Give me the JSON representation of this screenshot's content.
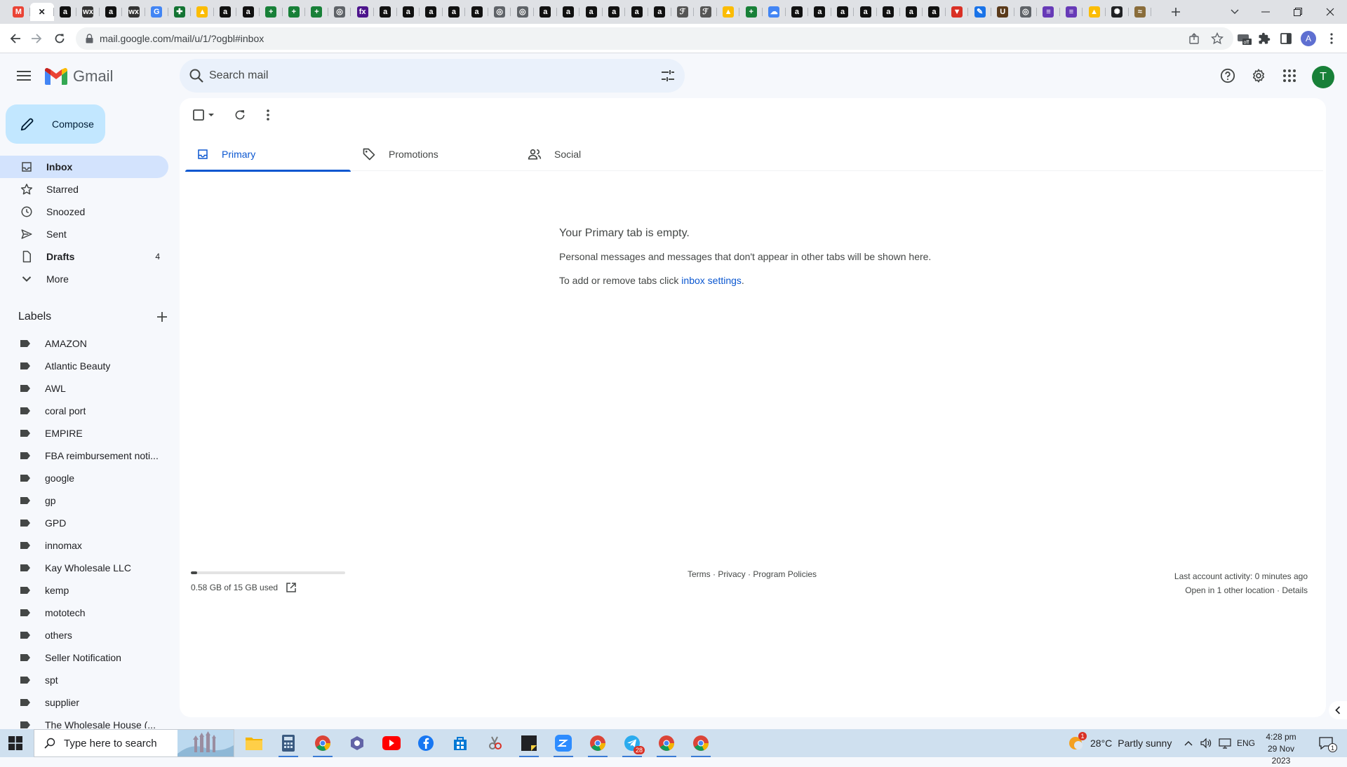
{
  "browser": {
    "tabs": [
      {
        "icon": "gmail-icon",
        "color": "#ea4335",
        "glyph": "M",
        "active": false
      },
      {
        "icon": "close-icon",
        "color": "#202124",
        "glyph": "✕",
        "active": true
      },
      {
        "icon": "amazon-icon",
        "color": "#111",
        "glyph": "a",
        "active": false
      },
      {
        "icon": "wix-icon",
        "color": "#333",
        "glyph": "wx",
        "active": false
      },
      {
        "icon": "amazon-icon",
        "color": "#111",
        "glyph": "a",
        "active": false
      },
      {
        "icon": "wix-icon",
        "color": "#333",
        "glyph": "wx",
        "active": false
      },
      {
        "icon": "google-icon",
        "color": "#4285f4",
        "glyph": "G",
        "active": false
      },
      {
        "icon": "extension-icon",
        "color": "#137333",
        "glyph": "✚",
        "active": false
      },
      {
        "icon": "drive-icon",
        "color": "#fbbc04",
        "glyph": "▲",
        "active": false
      },
      {
        "icon": "amazon-icon",
        "color": "#111",
        "glyph": "a",
        "active": false
      },
      {
        "icon": "amazon-icon",
        "color": "#111",
        "glyph": "a",
        "active": false
      },
      {
        "icon": "sheets-icon",
        "color": "#188038",
        "glyph": "+",
        "active": false
      },
      {
        "icon": "sheets-icon",
        "color": "#188038",
        "glyph": "+",
        "active": false
      },
      {
        "icon": "sheets-icon",
        "color": "#188038",
        "glyph": "+",
        "active": false
      },
      {
        "icon": "globe-icon",
        "color": "#5f6368",
        "glyph": "◎",
        "active": false
      },
      {
        "icon": "fedex-icon",
        "color": "#4d148c",
        "glyph": "fx",
        "active": false
      },
      {
        "icon": "amazon-icon",
        "color": "#111",
        "glyph": "a",
        "active": false
      },
      {
        "icon": "amazon-icon",
        "color": "#111",
        "glyph": "a",
        "active": false
      },
      {
        "icon": "amazon-icon",
        "color": "#111",
        "glyph": "a",
        "active": false
      },
      {
        "icon": "amazon-icon",
        "color": "#111",
        "glyph": "a",
        "active": false
      },
      {
        "icon": "amazon-icon",
        "color": "#111",
        "glyph": "a",
        "active": false
      },
      {
        "icon": "globe-icon",
        "color": "#5f6368",
        "glyph": "◎",
        "active": false
      },
      {
        "icon": "globe-icon",
        "color": "#5f6368",
        "glyph": "◎",
        "active": false
      },
      {
        "icon": "amazon-icon",
        "color": "#111",
        "glyph": "a",
        "active": false
      },
      {
        "icon": "amazon-icon",
        "color": "#111",
        "glyph": "a",
        "active": false
      },
      {
        "icon": "amazon-icon",
        "color": "#111",
        "glyph": "a",
        "active": false
      },
      {
        "icon": "amazon-icon",
        "color": "#111",
        "glyph": "a",
        "active": false
      },
      {
        "icon": "amazon-icon",
        "color": "#111",
        "glyph": "a",
        "active": false
      },
      {
        "icon": "amazon-icon",
        "color": "#111",
        "glyph": "a",
        "active": false
      },
      {
        "icon": "script-icon",
        "color": "#555",
        "glyph": "ℱ",
        "active": false
      },
      {
        "icon": "script-icon",
        "color": "#555",
        "glyph": "ℱ",
        "active": false
      },
      {
        "icon": "drive-icon",
        "color": "#fbbc04",
        "glyph": "▲",
        "active": false
      },
      {
        "icon": "sheets-icon",
        "color": "#188038",
        "glyph": "+",
        "active": false
      },
      {
        "icon": "cloud-icon",
        "color": "#4285f4",
        "glyph": "☁",
        "active": false
      },
      {
        "icon": "amazon-icon",
        "color": "#111",
        "glyph": "a",
        "active": false
      },
      {
        "icon": "amazon-icon",
        "color": "#111",
        "glyph": "a",
        "active": false
      },
      {
        "icon": "amazon-icon",
        "color": "#111",
        "glyph": "a",
        "active": false
      },
      {
        "icon": "amazon-icon",
        "color": "#111",
        "glyph": "a",
        "active": false
      },
      {
        "icon": "amazon-icon",
        "color": "#111",
        "glyph": "a",
        "active": false
      },
      {
        "icon": "amazon-icon",
        "color": "#111",
        "glyph": "a",
        "active": false
      },
      {
        "icon": "amazon-icon",
        "color": "#111",
        "glyph": "a",
        "active": false
      },
      {
        "icon": "vivaldi-icon",
        "color": "#d93025",
        "glyph": "▼",
        "active": false
      },
      {
        "icon": "pen-icon",
        "color": "#1a73e8",
        "glyph": "✎",
        "active": false
      },
      {
        "icon": "ups-icon",
        "color": "#5a3a1a",
        "glyph": "U",
        "active": false
      },
      {
        "icon": "globe-icon",
        "color": "#5f6368",
        "glyph": "◎",
        "active": false
      },
      {
        "icon": "forms-icon",
        "color": "#673ab7",
        "glyph": "≡",
        "active": false
      },
      {
        "icon": "forms-icon",
        "color": "#673ab7",
        "glyph": "≡",
        "active": false
      },
      {
        "icon": "drive-icon",
        "color": "#fbbc04",
        "glyph": "▲",
        "active": false
      },
      {
        "icon": "chatgpt-icon",
        "color": "#202124",
        "glyph": "✺",
        "active": false
      },
      {
        "icon": "shipping-icon",
        "color": "#8a6d3b",
        "glyph": "≈",
        "active": false
      }
    ],
    "url": "mail.google.com/mail/u/1/?ogbl#inbox",
    "profile_initial": "A"
  },
  "gmail": {
    "app_name": "Gmail",
    "search_placeholder": "Search mail",
    "user_initial": "T",
    "compose_label": "Compose",
    "nav": [
      {
        "id": "inbox",
        "label": "Inbox",
        "icon": "inbox-icon",
        "count": "",
        "active": true,
        "bold": true
      },
      {
        "id": "starred",
        "label": "Starred",
        "icon": "star-icon",
        "count": "",
        "active": false,
        "bold": false
      },
      {
        "id": "snoozed",
        "label": "Snoozed",
        "icon": "clock-icon",
        "count": "",
        "active": false,
        "bold": false
      },
      {
        "id": "sent",
        "label": "Sent",
        "icon": "send-icon",
        "count": "",
        "active": false,
        "bold": false
      },
      {
        "id": "drafts",
        "label": "Drafts",
        "icon": "draft-icon",
        "count": "4",
        "active": false,
        "bold": true
      },
      {
        "id": "more",
        "label": "More",
        "icon": "chevron-down-icon",
        "count": "",
        "active": false,
        "bold": false
      }
    ],
    "labels_title": "Labels",
    "labels": [
      "AMAZON",
      "Atlantic Beauty",
      "AWL",
      "coral port",
      "EMPIRE",
      "FBA reimbursement noti...",
      "google",
      "gp",
      "GPD",
      "innomax",
      "Kay Wholesale LLC",
      "kemp",
      "mototech",
      "others",
      "Seller Notification",
      "spt",
      "supplier",
      "The Wholesale House (..."
    ],
    "category_tabs": [
      {
        "id": "primary",
        "label": "Primary",
        "icon": "inbox-icon",
        "active": true
      },
      {
        "id": "promotions",
        "label": "Promotions",
        "icon": "tag-icon",
        "active": false
      },
      {
        "id": "social",
        "label": "Social",
        "icon": "people-icon",
        "active": false
      }
    ],
    "empty_state": {
      "title": "Your Primary tab is empty.",
      "line1": "Personal messages and messages that don't appear in other tabs will be shown here.",
      "line2_prefix": "To add or remove tabs click ",
      "line2_link": "inbox settings",
      "line2_suffix": "."
    },
    "storage": {
      "text": "0.58 GB of 15 GB used",
      "used_fraction": 0.039
    },
    "footer": {
      "terms": "Terms",
      "sep1": " · ",
      "privacy": "Privacy",
      "sep2": " · ",
      "policies": "Program Policies",
      "activity": "Last account activity: 0 minutes ago",
      "open_location": "Open in 1 other location",
      "sep3": " · ",
      "details": "Details"
    }
  },
  "taskbar": {
    "search_placeholder": "Type here to search",
    "apps": [
      {
        "icon": "file-explorer-icon",
        "color": "#f4b400",
        "running": false
      },
      {
        "icon": "calculator-icon",
        "color": "#3a5a80",
        "running": true
      },
      {
        "icon": "chrome-icon",
        "color": "#db4437",
        "running": true
      },
      {
        "icon": "teams-icon",
        "color": "#6264a7",
        "running": false
      },
      {
        "icon": "youtube-icon",
        "color": "#ff0000",
        "running": false
      },
      {
        "icon": "facebook-icon",
        "color": "#1877f2",
        "running": false
      },
      {
        "icon": "store-icon",
        "color": "#0078d4",
        "running": false
      },
      {
        "icon": "snipping-tool-icon",
        "color": "#7a7a7a",
        "running": false
      },
      {
        "icon": "sticky-notes-icon",
        "color": "#202124",
        "running": true
      },
      {
        "icon": "zoom-icon",
        "color": "#2d8cff",
        "running": true
      },
      {
        "icon": "chrome-icon",
        "color": "#db4437",
        "running": true
      },
      {
        "icon": "telegram-icon",
        "color": "#2aabee",
        "running": true
      },
      {
        "icon": "chrome-icon",
        "color": "#db4437",
        "running": true
      },
      {
        "icon": "chrome-icon",
        "color": "#db4437",
        "running": true
      }
    ],
    "telegram_badge": "28",
    "weather_alert": "1",
    "temperature": "28°C",
    "weather": "Partly sunny",
    "language": "ENG",
    "time": "4:28 pm",
    "date": "29 Nov 2023",
    "notification_count": "1"
  }
}
